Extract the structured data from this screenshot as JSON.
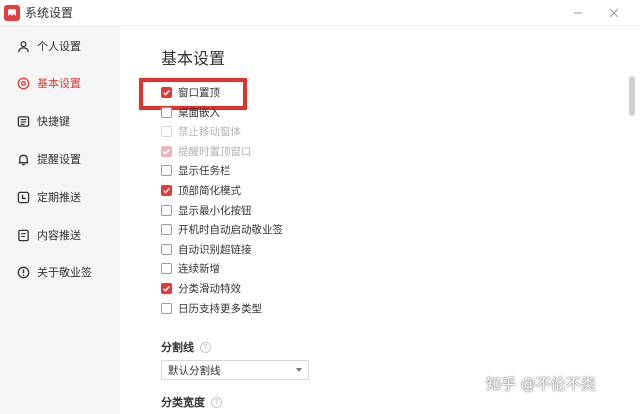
{
  "window": {
    "title": "系统设置"
  },
  "sidebar": {
    "items": [
      {
        "label": "个人设置",
        "icon": "user-icon"
      },
      {
        "label": "基本设置",
        "icon": "settings-icon",
        "active": true
      },
      {
        "label": "快捷键",
        "icon": "keyboard-icon"
      },
      {
        "label": "提醒设置",
        "icon": "bell-icon"
      },
      {
        "label": "定期推送",
        "icon": "clock-icon"
      },
      {
        "label": "内容推送",
        "icon": "document-icon"
      },
      {
        "label": "关于敬业签",
        "icon": "info-icon"
      }
    ]
  },
  "main": {
    "title": "基本设置",
    "options": [
      {
        "label": "窗口置顶",
        "checked": true,
        "disabled": false
      },
      {
        "label": "桌面嵌入",
        "checked": false,
        "disabled": false
      },
      {
        "label": "禁止移动窗体",
        "checked": false,
        "disabled": true
      },
      {
        "label": "提醒时置顶窗口",
        "checked": true,
        "disabled": true
      },
      {
        "label": "显示任务栏",
        "checked": false,
        "disabled": false
      },
      {
        "label": "顶部简化模式",
        "checked": true,
        "disabled": false
      },
      {
        "label": "显示最小化按钮",
        "checked": false,
        "disabled": false
      },
      {
        "label": "开机时自动启动敬业签",
        "checked": false,
        "disabled": false
      },
      {
        "label": "自动识别超链接",
        "checked": false,
        "disabled": false
      },
      {
        "label": "连续新增",
        "checked": false,
        "disabled": false
      },
      {
        "label": "分类滑动特效",
        "checked": true,
        "disabled": false
      },
      {
        "label": "日历支持更多类型",
        "checked": false,
        "disabled": false
      }
    ],
    "divider": {
      "label": "分割线",
      "value": "默认分割线"
    },
    "category_width": {
      "label": "分类宽度"
    }
  },
  "watermark": "知乎 @不伦不类",
  "colors": {
    "accent": "#e53935",
    "highlight": "#e8302b"
  }
}
